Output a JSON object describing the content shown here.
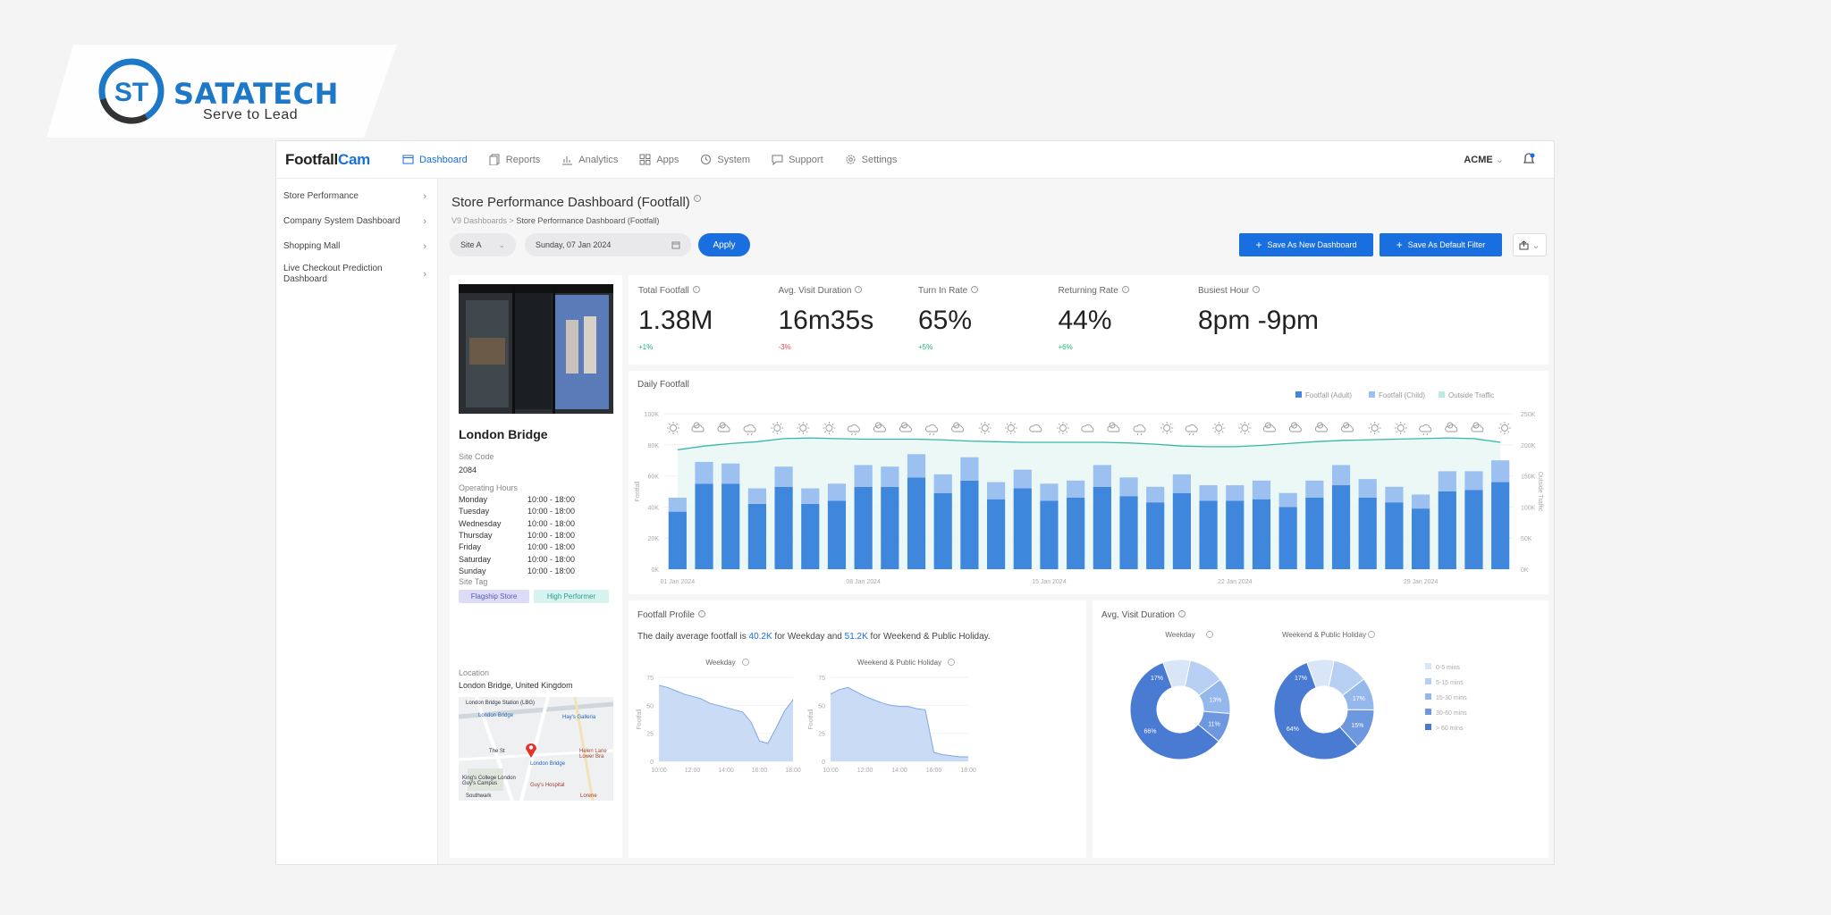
{
  "brand": {
    "name": "SATATECH",
    "tagline": "Serve to Lead",
    "monogram": "ST"
  },
  "app": {
    "logo_a": "Footfall",
    "logo_b": "Cam",
    "nav": [
      {
        "label": "Dashboard",
        "icon": "dashboard-icon",
        "active": true
      },
      {
        "label": "Reports",
        "icon": "reports-icon"
      },
      {
        "label": "Analytics",
        "icon": "analytics-icon"
      },
      {
        "label": "Apps",
        "icon": "apps-icon"
      },
      {
        "label": "System",
        "icon": "system-icon"
      },
      {
        "label": "Support",
        "icon": "support-icon"
      },
      {
        "label": "Settings",
        "icon": "settings-icon"
      }
    ],
    "account": "ACME",
    "sidebar": [
      {
        "label": "Store Performance"
      },
      {
        "label": "Company System Dashboard"
      },
      {
        "label": "Shopping Mall"
      },
      {
        "label": "Live Checkout Prediction Dashboard"
      }
    ]
  },
  "page": {
    "title": "Store Performance Dashboard (Footfall)",
    "crumb_root": "V9 Dashboards",
    "crumb_current": "Store Performance Dashboard (Footfall)",
    "site_filter": "Site A",
    "date_filter": "Sunday, 07 Jan 2024",
    "apply": "Apply",
    "save_new": "Save As New Dashboard",
    "save_default": "Save As Default Filter"
  },
  "store": {
    "name": "London Bridge",
    "site_code_label": "Site Code",
    "site_code": "2084",
    "hours_label": "Operating Hours",
    "hours": [
      {
        "day": "Monday",
        "time": "10:00 - 18:00"
      },
      {
        "day": "Tuesday",
        "time": "10:00 - 18:00"
      },
      {
        "day": "Wednesday",
        "time": "10:00 - 18:00"
      },
      {
        "day": "Thursday",
        "time": "10:00 - 18:00"
      },
      {
        "day": "Friday",
        "time": "10:00 - 18:00"
      },
      {
        "day": "Saturday",
        "time": "10:00 - 18:00"
      },
      {
        "day": "Sunday",
        "time": "10:00 - 18:00"
      }
    ],
    "tag_label": "Site Tag",
    "tags": [
      "Flagship Store",
      "High Performer"
    ],
    "location_label": "Location",
    "location": "London Bridge, United Kingdom",
    "map_labels": [
      "London Bridge Station (LBG)",
      "London Bridge",
      "Hay's Galleria",
      "The St",
      "London Bridge",
      "Helen Lane Lower Bra",
      "King's College London Guy's Campus",
      "Guy's Hospital",
      "Southwark",
      "Lorene"
    ]
  },
  "kpis": [
    {
      "label": "Total Footfall",
      "value": "1.38M",
      "change": "+1%",
      "dir": "up"
    },
    {
      "label": "Avg. Visit Duration",
      "value": "16m35s",
      "change": "-3%",
      "dir": "down"
    },
    {
      "label": "Turn In Rate",
      "value": "65%",
      "change": "+5%",
      "dir": "up"
    },
    {
      "label": "Returning Rate",
      "value": "44%",
      "change": "+6%",
      "dir": "up"
    },
    {
      "label": "Busiest Hour",
      "value": "8pm -9pm",
      "change": "",
      "dir": "up"
    }
  ],
  "colors": {
    "primary": "#1a6fe0",
    "up": "#1fb97a",
    "down": "#e04747",
    "adult": "#3f86dd",
    "child": "#9cc0ef",
    "traffic": "#36b8a8"
  },
  "chart_data": [
    {
      "type": "bar",
      "title": "Daily Footfall",
      "ylabel": "Footfall",
      "y2label": "Outside Traffic",
      "ylim": [
        0,
        100000
      ],
      "y2lim": [
        0,
        250000
      ],
      "yticks": [
        "0K",
        "20K",
        "40K",
        "60K",
        "80K",
        "100K"
      ],
      "y2ticks": [
        "0K",
        "50K",
        "100K",
        "150K",
        "200K",
        "250K"
      ],
      "x_tick_labels": [
        "01 Jan 2024",
        "08 Jan 2024",
        "15 Jan 2024",
        "22 Jan 2024",
        "29 Jan 2024"
      ],
      "legend": [
        "Footfall (Adult)",
        "Footfall (Child)",
        "Outside Traffic"
      ],
      "legend_position": "top-right",
      "weather": [
        "sun",
        "cloud-sun",
        "cloud-sun",
        "cloud-rain",
        "sun",
        "sun",
        "sun",
        "cloud-rain",
        "cloud-sun",
        "cloud-sun",
        "cloud-rain",
        "cloud-sun",
        "sun",
        "sun",
        "cloud",
        "sun",
        "cloud",
        "cloud-sun",
        "cloud-rain",
        "sun",
        "cloud-rain",
        "sun",
        "sun",
        "cloud-sun",
        "cloud-sun",
        "cloud-sun",
        "cloud-sun",
        "sun",
        "sun",
        "cloud-rain",
        "cloud-sun",
        "cloud-sun",
        "sun"
      ],
      "series": [
        {
          "name": "Footfall (Adult)",
          "values": [
            37000,
            55000,
            55000,
            42000,
            53000,
            42000,
            44000,
            53000,
            53000,
            59000,
            49000,
            57000,
            45000,
            52000,
            44000,
            46000,
            53000,
            47000,
            43000,
            49000,
            44000,
            44000,
            45000,
            40000,
            46000,
            54000,
            46000,
            43000,
            39000,
            50000,
            51000,
            56000
          ]
        },
        {
          "name": "Footfall (Child)",
          "values": [
            9000,
            14000,
            13000,
            10000,
            13000,
            10000,
            11000,
            14000,
            13000,
            15000,
            12000,
            15000,
            11000,
            12000,
            11000,
            11000,
            14000,
            12000,
            10000,
            12000,
            10000,
            10000,
            12000,
            9000,
            11000,
            13000,
            12000,
            10000,
            9000,
            13000,
            12000,
            14000
          ]
        },
        {
          "name": "Outside Traffic",
          "values": [
            192000,
            198000,
            202000,
            205000,
            210000,
            211000,
            210000,
            209000,
            209000,
            209000,
            208000,
            206000,
            205000,
            204000,
            204000,
            204000,
            204000,
            203000,
            201000,
            198000,
            197000,
            197000,
            199000,
            202000,
            205000,
            207000,
            208000,
            209000,
            210000,
            211000,
            210000,
            204000
          ]
        }
      ]
    },
    {
      "type": "area",
      "title": "Weekday",
      "ylabel": "Footfall",
      "ylim": [
        0,
        75
      ],
      "yticks": [
        "0",
        "25",
        "50",
        "75"
      ],
      "x_tick_labels": [
        "10:00",
        "12:00",
        "14:00",
        "16:00",
        "18:00"
      ],
      "x": [
        "10:00",
        "10:30",
        "11:00",
        "11:30",
        "12:00",
        "12:30",
        "13:00",
        "13:30",
        "14:00",
        "14:30",
        "15:00",
        "15:30",
        "16:00",
        "16:30",
        "17:00",
        "17:30",
        "18:00"
      ],
      "values": [
        68,
        66,
        63,
        60,
        58,
        56,
        52,
        50,
        48,
        46,
        44,
        35,
        18,
        16,
        30,
        45,
        55
      ]
    },
    {
      "type": "area",
      "title": "Weekend & Public Holiday",
      "ylabel": "Footfall",
      "ylim": [
        0,
        75
      ],
      "yticks": [
        "0",
        "25",
        "50",
        "75"
      ],
      "x_tick_labels": [
        "10:00",
        "12:00",
        "14:00",
        "16:00",
        "18:00"
      ],
      "x": [
        "10:00",
        "10:30",
        "11:00",
        "11:30",
        "12:00",
        "12:30",
        "13:00",
        "13:30",
        "14:00",
        "14:30",
        "15:00",
        "15:30",
        "16:00",
        "16:30",
        "17:00",
        "17:30",
        "18:00"
      ],
      "values": [
        60,
        64,
        66,
        62,
        58,
        55,
        52,
        50,
        49,
        49,
        47,
        46,
        8,
        6,
        5,
        4,
        4
      ]
    },
    {
      "type": "pie",
      "title": "Weekday",
      "categories": [
        "0-5 mins",
        "5-15 mins",
        "15-30 mins",
        "30-60 mins",
        "> 60 mins"
      ],
      "values": [
        10,
        13,
        13,
        11,
        66
      ],
      "labels": [
        "",
        "",
        "13%",
        "11%",
        "66%"
      ],
      "label_top_left": "17%",
      "colors": [
        "#d9e6f8",
        "#b7cff2",
        "#94b8ec",
        "#6d98e0",
        "#4a7bd3"
      ]
    },
    {
      "type": "pie",
      "title": "Weekend & Public Holiday",
      "categories": [
        "0-5 mins",
        "5-15 mins",
        "15-30 mins",
        "30-60 mins",
        "> 60 mins"
      ],
      "values": [
        10,
        13,
        12,
        15,
        64
      ],
      "labels": [
        "",
        "",
        "17%",
        "15%",
        "64%"
      ],
      "label_top_left": "17%",
      "colors": [
        "#d9e6f8",
        "#b7cff2",
        "#94b8ec",
        "#6d98e0",
        "#4a7bd3"
      ]
    }
  ],
  "profile": {
    "title": "Footfall Profile",
    "desc_a": "The daily average footfall is ",
    "weekday_avg": "40.2K",
    "desc_b": " for Weekday and ",
    "weekend_avg": "51.2K",
    "desc_c": " for Weekend & Public Holiday."
  },
  "duration": {
    "title": "Avg. Visit Duration",
    "legend": [
      "0-5 mins",
      "5-15 mins",
      "15-30 mins",
      "30-60 mins",
      "> 60 mins"
    ]
  }
}
